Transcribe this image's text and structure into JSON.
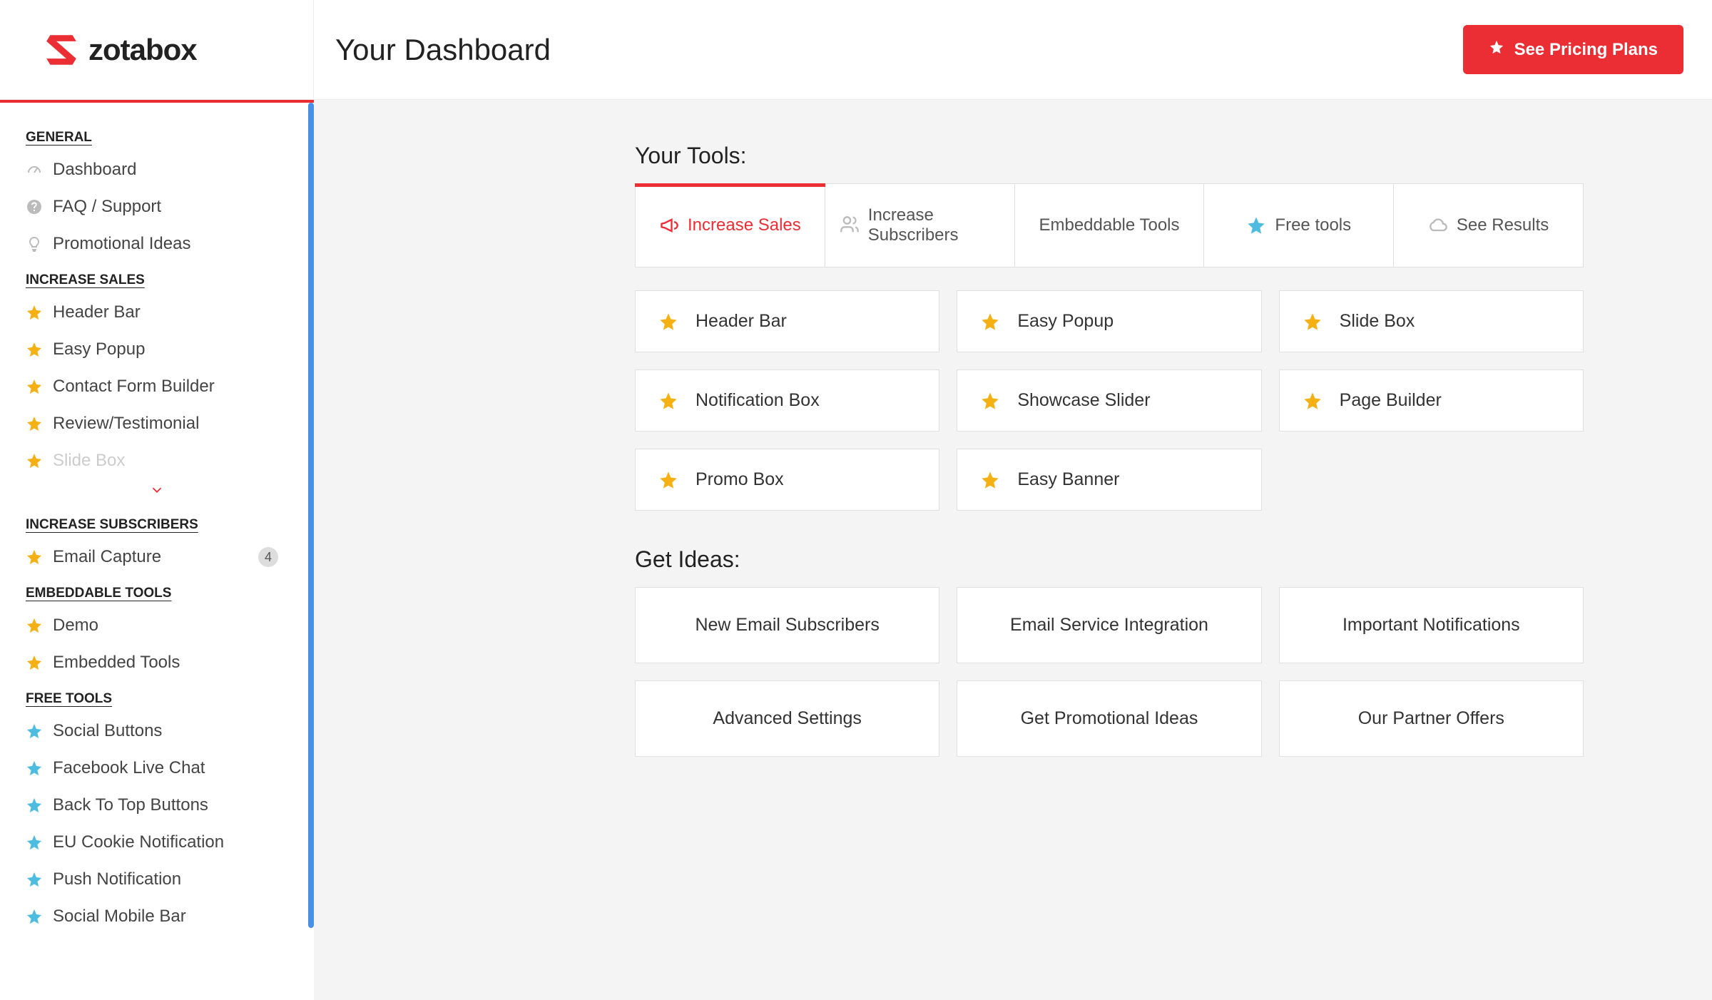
{
  "brand": "zotabox",
  "header": {
    "title": "Your Dashboard",
    "pricing_button": "See Pricing Plans"
  },
  "sidebar": {
    "sections": [
      {
        "title": "GENERAL",
        "items": [
          {
            "label": "Dashboard",
            "icon": "gauge"
          },
          {
            "label": "FAQ / Support",
            "icon": "question"
          },
          {
            "label": "Promotional Ideas",
            "icon": "bulb"
          }
        ]
      },
      {
        "title": "INCREASE SALES",
        "items": [
          {
            "label": "Header Bar",
            "icon": "star-gold"
          },
          {
            "label": "Easy Popup",
            "icon": "star-gold"
          },
          {
            "label": "Contact Form Builder",
            "icon": "star-gold"
          },
          {
            "label": "Review/Testimonial",
            "icon": "star-gold"
          },
          {
            "label": "Slide Box",
            "icon": "star-gold",
            "faded": true
          }
        ],
        "expandable": true
      },
      {
        "title": "INCREASE SUBSCRIBERS",
        "items": [
          {
            "label": "Email Capture",
            "icon": "star-gold",
            "badge": "4"
          }
        ]
      },
      {
        "title": "EMBEDDABLE TOOLS",
        "items": [
          {
            "label": "Demo",
            "icon": "star-gold"
          },
          {
            "label": "Embedded Tools",
            "icon": "star-gold"
          }
        ]
      },
      {
        "title": "FREE TOOLS",
        "items": [
          {
            "label": "Social Buttons",
            "icon": "star-blue"
          },
          {
            "label": "Facebook Live Chat",
            "icon": "star-blue"
          },
          {
            "label": "Back To Top Buttons",
            "icon": "star-blue"
          },
          {
            "label": "EU Cookie Notification",
            "icon": "star-blue"
          },
          {
            "label": "Push Notification",
            "icon": "star-blue"
          },
          {
            "label": "Social Mobile Bar",
            "icon": "star-blue"
          }
        ]
      }
    ]
  },
  "main": {
    "tools_heading": "Your Tools:",
    "tabs": [
      {
        "label": "Increase Sales",
        "icon": "megaphone",
        "active": true
      },
      {
        "label": "Increase Subscribers",
        "icon": "users"
      },
      {
        "label": "Embeddable Tools",
        "icon": ""
      },
      {
        "label": "Free tools",
        "icon": "star-blue"
      },
      {
        "label": "See Results",
        "icon": "cloud"
      }
    ],
    "tool_cards": [
      "Header Bar",
      "Easy Popup",
      "Slide Box",
      "Notification Box",
      "Showcase Slider",
      "Page Builder",
      "Promo Box",
      "Easy Banner"
    ],
    "ideas_heading": "Get Ideas:",
    "idea_cards": [
      "New Email Subscribers",
      "Email Service Integration",
      "Important Notifications",
      "Advanced Settings",
      "Get Promotional Ideas",
      "Our Partner Offers"
    ]
  }
}
